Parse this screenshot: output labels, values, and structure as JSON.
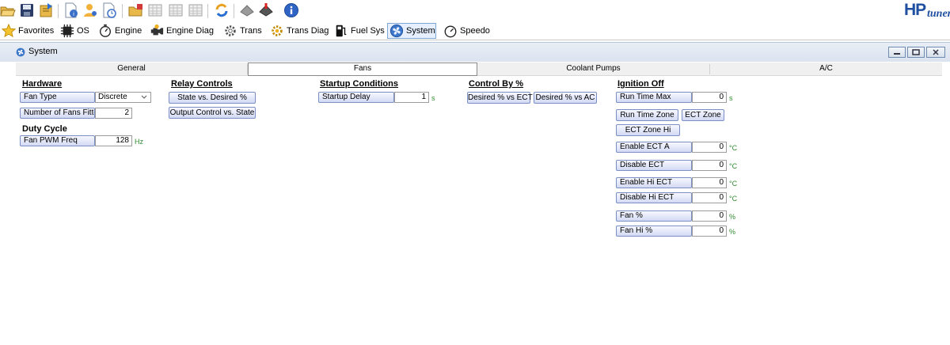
{
  "logo": {
    "brand": "HP",
    "suffix": "tuners"
  },
  "nav": [
    {
      "label": "Favorites",
      "icon": "star-icon"
    },
    {
      "label": "OS",
      "icon": "chip-icon"
    },
    {
      "label": "Engine",
      "icon": "stopwatch-icon"
    },
    {
      "label": "Engine Diag",
      "icon": "engine-icon"
    },
    {
      "label": "Trans",
      "icon": "gear-icon"
    },
    {
      "label": "Trans Diag",
      "icon": "gear-warning-icon"
    },
    {
      "label": "Fuel Sys",
      "icon": "fuel-pump-icon"
    },
    {
      "label": "System",
      "icon": "fan-icon",
      "active": true
    },
    {
      "label": "Speedo",
      "icon": "speedometer-icon"
    }
  ],
  "window": {
    "title": "System"
  },
  "tabs": [
    "General",
    "Fans",
    "Coolant Pumps",
    "A/C"
  ],
  "active_tab": "Fans",
  "hardware": {
    "heading": "Hardware",
    "fan_type_label": "Fan Type",
    "fan_type_value": "Discrete",
    "fans_fitted_label": "Number of Fans Fitted",
    "fans_fitted_value": "2"
  },
  "duty_cycle": {
    "heading": "Duty Cycle",
    "pwm_label": "Fan PWM Freq",
    "pwm_value": "128",
    "pwm_unit": "Hz"
  },
  "relay": {
    "heading": "Relay Controls",
    "state_button": "State vs. Desired %",
    "output_button": "Output Control vs. State"
  },
  "startup": {
    "heading": "Startup Conditions",
    "delay_label": "Startup Delay",
    "delay_value": "1",
    "delay_unit": "s"
  },
  "control": {
    "heading": "Control By %",
    "ect_button": "Desired % vs ECT",
    "ac_button": "Desired % vs AC"
  },
  "ignition": {
    "heading": "Ignition Off",
    "run_time_label": "Run Time Max",
    "run_time_value": "0",
    "run_time_unit": "s",
    "run_time_zone_button": "Run Time Zone",
    "ect_zone_button": "ECT Zone",
    "ect_zone_hi_button": "ECT Zone Hi",
    "enable_ect_a_label": "Enable ECT A",
    "enable_ect_a_value": "0",
    "disable_ect_label": "Disable ECT",
    "disable_ect_value": "0",
    "enable_hi_ect_label": "Enable Hi ECT",
    "enable_hi_ect_value": "0",
    "disable_hi_ect_label": "Disable Hi ECT",
    "disable_hi_ect_value": "0",
    "fan_pct_label": "Fan %",
    "fan_pct_value": "0",
    "fan_hi_pct_label": "Fan Hi %",
    "fan_hi_pct_value": "0",
    "temp_unit": "°C",
    "pct_unit": "%"
  },
  "colors": {
    "accent": "#1f4fa0",
    "unit_green": "#2e8b2e",
    "button_border": "#7a8fc4"
  }
}
